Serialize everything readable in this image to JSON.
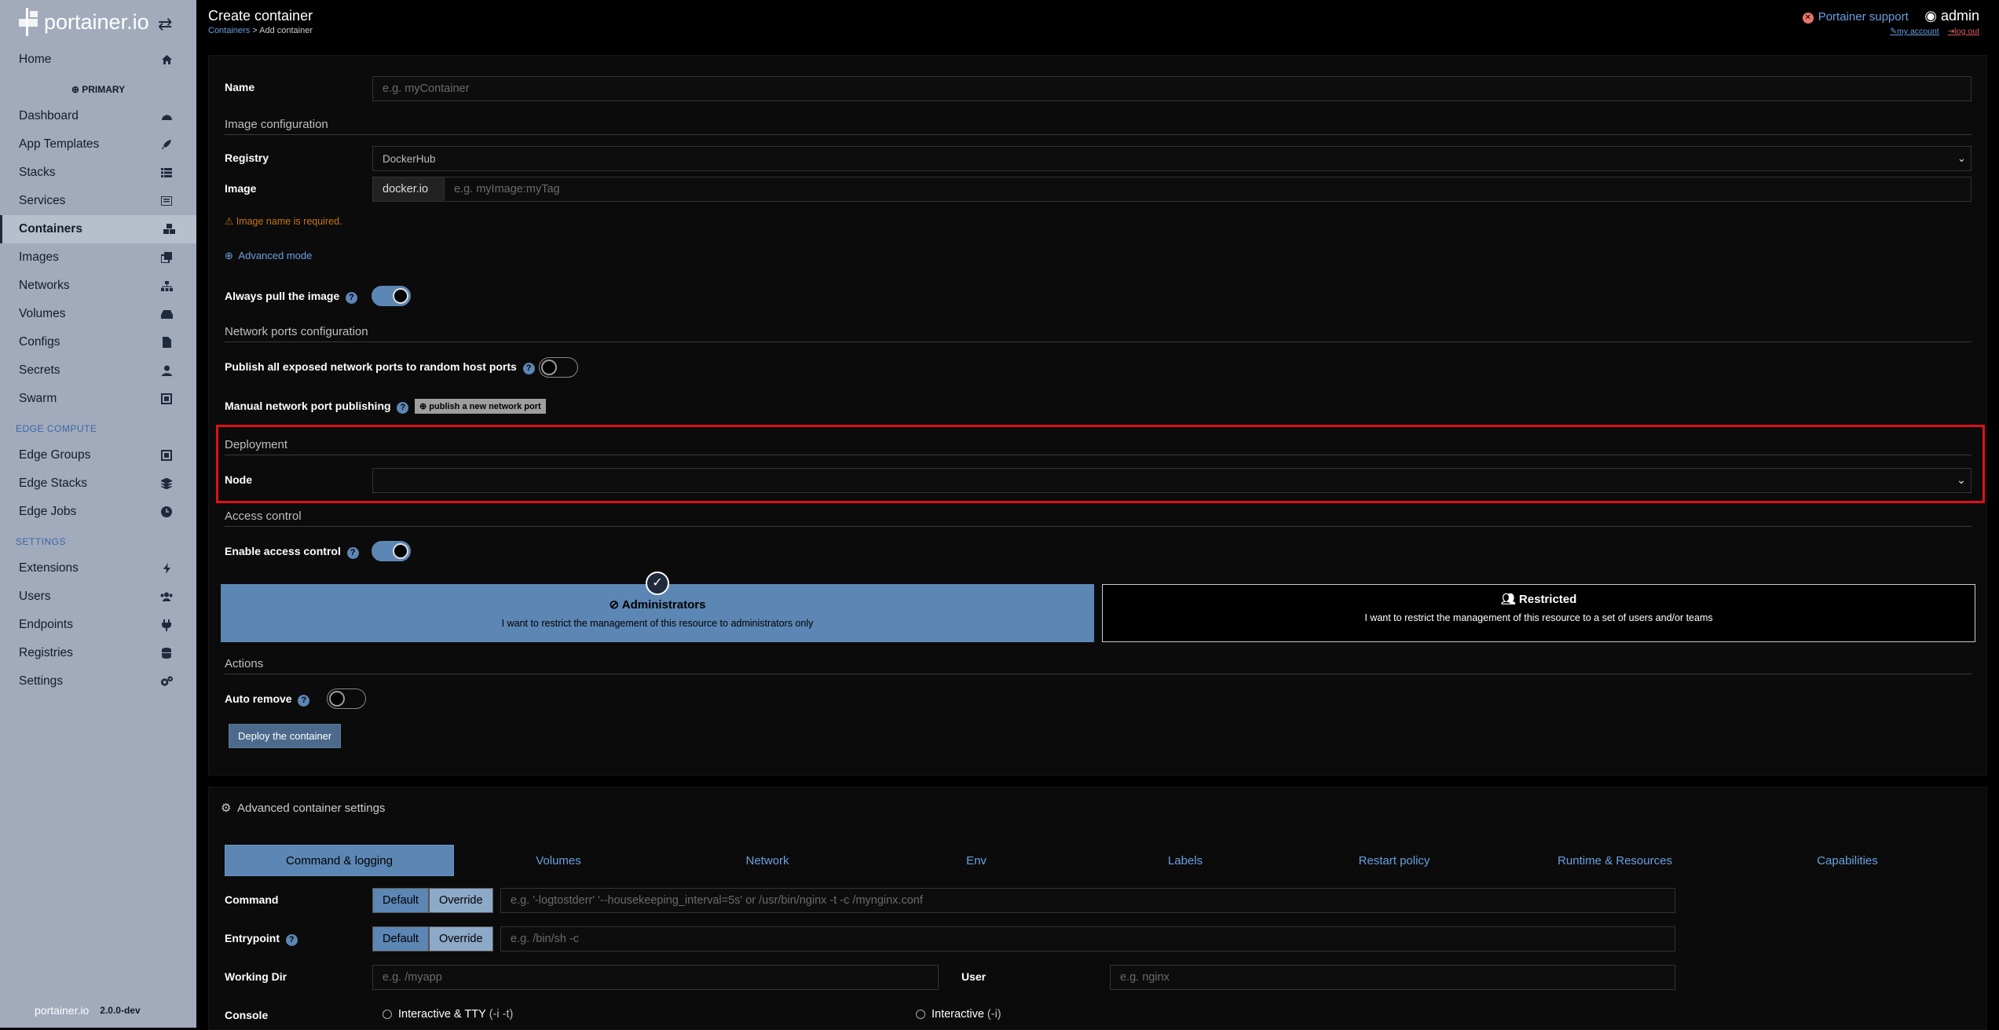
{
  "sidebar": {
    "logo_text": "portainer.io",
    "items": [
      {
        "label": "Home",
        "icon": "home-icon"
      },
      {
        "label": "Dashboard",
        "icon": "tachometer-icon"
      },
      {
        "label": "App Templates",
        "icon": "rocket-icon"
      },
      {
        "label": "Stacks",
        "icon": "th-list-icon"
      },
      {
        "label": "Services",
        "icon": "list-alt-icon"
      },
      {
        "label": "Containers",
        "icon": "cubes-icon"
      },
      {
        "label": "Images",
        "icon": "clone-icon"
      },
      {
        "label": "Networks",
        "icon": "sitemap-icon"
      },
      {
        "label": "Volumes",
        "icon": "hdd-icon"
      },
      {
        "label": "Configs",
        "icon": "file-code-icon"
      },
      {
        "label": "Secrets",
        "icon": "user-secret-icon"
      },
      {
        "label": "Swarm",
        "icon": "object-group-icon"
      },
      {
        "label": "Edge Groups",
        "icon": "object-group-icon"
      },
      {
        "label": "Edge Stacks",
        "icon": "layer-group-icon"
      },
      {
        "label": "Edge Jobs",
        "icon": "clock-icon"
      },
      {
        "label": "Extensions",
        "icon": "bolt-icon"
      },
      {
        "label": "Users",
        "icon": "users-icon"
      },
      {
        "label": "Endpoints",
        "icon": "plug-icon"
      },
      {
        "label": "Registries",
        "icon": "database-icon"
      },
      {
        "label": "Settings",
        "icon": "cogs-icon"
      }
    ],
    "endpoint": "PRIMARY",
    "edge_heading": "EDGE COMPUTE",
    "settings_heading": "SETTINGS",
    "footer_logo": "portainer.io",
    "version": "2.0.0-dev"
  },
  "header": {
    "title": "Create container",
    "crumb_link": "Containers",
    "crumb_current": "> Add container",
    "support": "Portainer support",
    "user": "admin",
    "my_account": "my account",
    "logout": "log out"
  },
  "form": {
    "name_label": "Name",
    "name_placeholder": "e.g. myContainer",
    "image_config": "Image configuration",
    "registry_label": "Registry",
    "registry_value": "DockerHub",
    "image_label": "Image",
    "image_prefix": "docker.io",
    "image_placeholder": "e.g. myImage:myTag",
    "image_error": "Image name is required.",
    "advanced_mode": "Advanced mode",
    "always_pull": "Always pull the image",
    "network_ports": "Network ports configuration",
    "publish_all": "Publish all exposed network ports to random host ports",
    "manual_publish": "Manual network port publishing",
    "publish_new": "publish a new network port",
    "deployment": "Deployment",
    "node_label": "Node",
    "access_control": "Access control",
    "enable_access": "Enable access control",
    "admin_title": "Administrators",
    "admin_desc": "I want to restrict the management of this resource to administrators only",
    "restricted_title": "Restricted",
    "restricted_desc": "I want to restrict the management of this resource to a set of users and/or teams",
    "actions": "Actions",
    "auto_remove": "Auto remove",
    "deploy": "Deploy the container"
  },
  "advanced": {
    "title": "Advanced container settings",
    "tabs": [
      "Command & logging",
      "Volumes",
      "Network",
      "Env",
      "Labels",
      "Restart policy",
      "Runtime & Resources",
      "Capabilities"
    ],
    "command_label": "Command",
    "default": "Default",
    "override": "Override",
    "command_placeholder": "e.g. '-logtostderr' '--housekeeping_interval=5s' or /usr/bin/nginx -t -c /mynginx.conf",
    "entrypoint_label": "Entrypoint",
    "entrypoint_placeholder": "e.g. /bin/sh -c",
    "workdir_label": "Working Dir",
    "workdir_placeholder": "e.g. /myapp",
    "user_label": "User",
    "user_placeholder": "e.g. nginx",
    "console_label": "Console",
    "console_opt1": "Interactive & TTY",
    "console_opt1_flag": "(-i -t)",
    "console_opt2": "Interactive",
    "console_opt2_flag": "(-i)"
  }
}
